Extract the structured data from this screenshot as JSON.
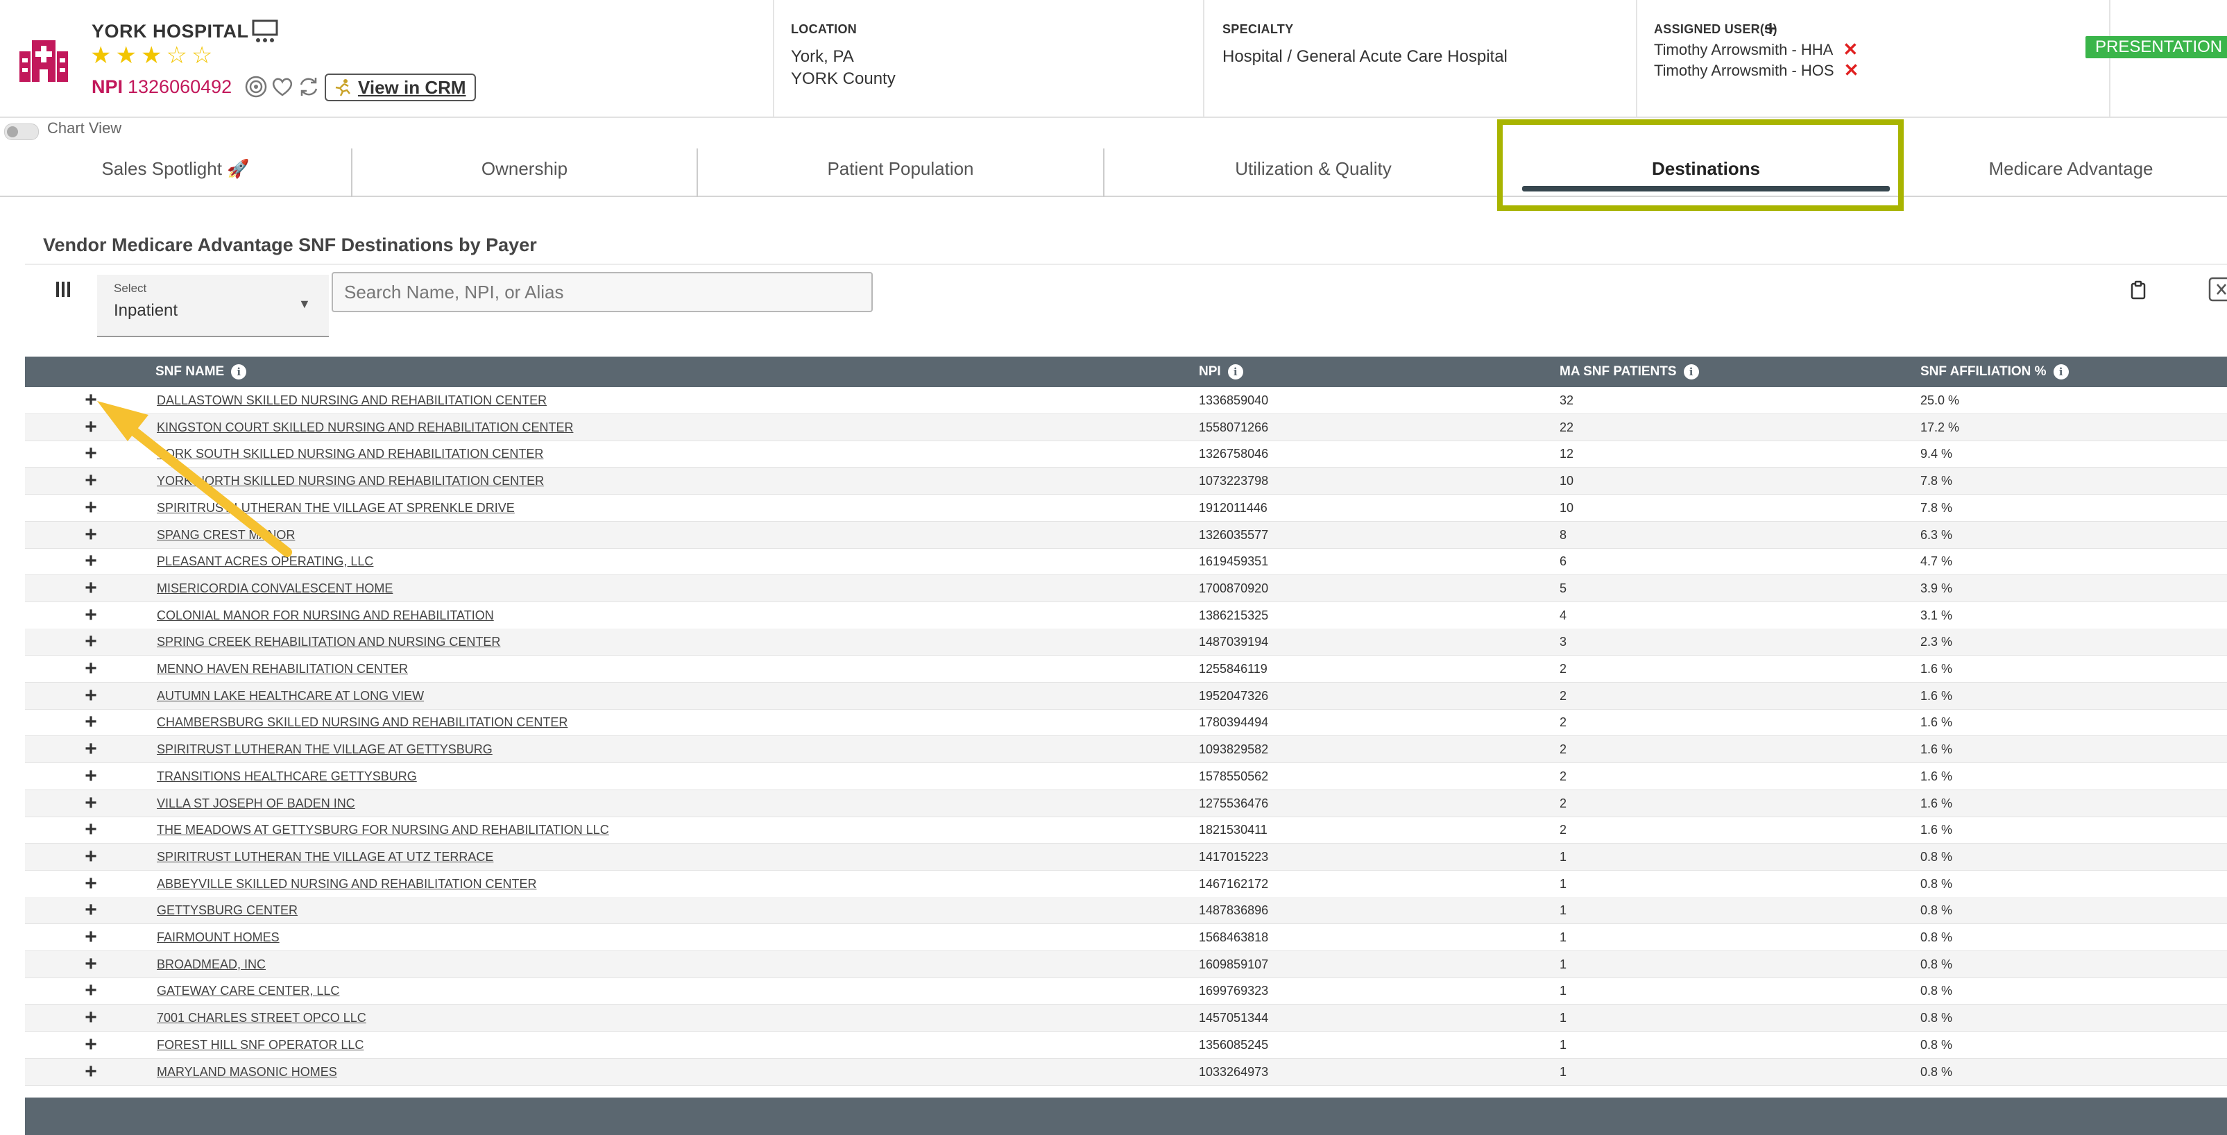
{
  "header": {
    "hospital_name": "YORK HOSPITAL",
    "stars": "★★★☆☆",
    "npi_label": "NPI",
    "npi_value": "1326060492",
    "view_crm_label": "View in CRM",
    "location_label": "LOCATION",
    "location_city": "York, PA",
    "location_county": "YORK County",
    "specialty_label": "SPECIALTY",
    "specialty_value": "Hospital / General Acute Care Hospital",
    "assigned_label": "ASSIGNED USER(S)",
    "assigned_users": [
      "Timothy Arrowsmith - HHA",
      "Timothy Arrowsmith - HOS"
    ],
    "status_badge": "PRESENTATION"
  },
  "chart_view_label": "Chart View",
  "tabs": [
    {
      "label": "Sales Spotlight 🚀"
    },
    {
      "label": "Ownership"
    },
    {
      "label": "Patient Population"
    },
    {
      "label": "Utilization & Quality"
    },
    {
      "label": "Destinations"
    },
    {
      "label": "Medicare Advantage"
    }
  ],
  "section_title": "Vendor Medicare Advantage SNF Destinations by Payer",
  "filter": {
    "select_label": "Select",
    "select_value": "Inpatient",
    "search_placeholder": "Search Name, NPI, or Alias"
  },
  "table": {
    "columns": [
      "SNF NAME",
      "NPI",
      "MA SNF PATIENTS",
      "SNF AFFILIATION %"
    ],
    "rows": [
      [
        "DALLASTOWN SKILLED NURSING AND REHABILITATION CENTER",
        "1336859040",
        "32",
        "25.0 %"
      ],
      [
        "KINGSTON COURT SKILLED NURSING AND REHABILITATION CENTER",
        "1558071266",
        "22",
        "17.2 %"
      ],
      [
        "YORK SOUTH SKILLED NURSING AND REHABILITATION CENTER",
        "1326758046",
        "12",
        "9.4 %"
      ],
      [
        "YORK NORTH SKILLED NURSING AND REHABILITATION CENTER",
        "1073223798",
        "10",
        "7.8 %"
      ],
      [
        "SPIRITRUST LUTHERAN THE VILLAGE AT SPRENKLE DRIVE",
        "1912011446",
        "10",
        "7.8 %"
      ],
      [
        "SPANG CREST MANOR",
        "1326035577",
        "8",
        "6.3 %"
      ],
      [
        "PLEASANT ACRES OPERATING, LLC",
        "1619459351",
        "6",
        "4.7 %"
      ],
      [
        "MISERICORDIA CONVALESCENT HOME",
        "1700870920",
        "5",
        "3.9 %"
      ],
      [
        "COLONIAL MANOR FOR NURSING AND REHABILITATION",
        "1386215325",
        "4",
        "3.1 %"
      ],
      [
        "SPRING CREEK REHABILITATION AND NURSING CENTER",
        "1487039194",
        "3",
        "2.3 %"
      ],
      [
        "MENNO HAVEN REHABILITATION CENTER",
        "1255846119",
        "2",
        "1.6 %"
      ],
      [
        "AUTUMN LAKE HEALTHCARE AT LONG VIEW",
        "1952047326",
        "2",
        "1.6 %"
      ],
      [
        "CHAMBERSBURG SKILLED NURSING AND REHABILITATION CENTER",
        "1780394494",
        "2",
        "1.6 %"
      ],
      [
        "SPIRITRUST LUTHERAN THE VILLAGE AT GETTYSBURG",
        "1093829582",
        "2",
        "1.6 %"
      ],
      [
        "TRANSITIONS HEALTHCARE GETTYSBURG",
        "1578550562",
        "2",
        "1.6 %"
      ],
      [
        "VILLA ST JOSEPH OF BADEN INC",
        "1275536476",
        "2",
        "1.6 %"
      ],
      [
        "THE MEADOWS AT GETTYSBURG FOR NURSING AND REHABILITATION LLC",
        "1821530411",
        "2",
        "1.6 %"
      ],
      [
        "SPIRITRUST LUTHERAN THE VILLAGE AT UTZ TERRACE",
        "1417015223",
        "1",
        "0.8 %"
      ],
      [
        "ABBEYVILLE SKILLED NURSING AND REHABILITATION CENTER",
        "1467162172",
        "1",
        "0.8 %"
      ],
      [
        "GETTYSBURG CENTER",
        "1487836896",
        "1",
        "0.8 %"
      ],
      [
        "FAIRMOUNT HOMES",
        "1568463818",
        "1",
        "0.8 %"
      ],
      [
        "BROADMEAD, INC",
        "1609859107",
        "1",
        "0.8 %"
      ],
      [
        "GATEWAY CARE CENTER, LLC",
        "1699769323",
        "1",
        "0.8 %"
      ],
      [
        "7001 CHARLES STREET OPCO LLC",
        "1457051344",
        "1",
        "0.8 %"
      ],
      [
        "FOREST HILL SNF OPERATOR LLC",
        "1356085245",
        "1",
        "0.8 %"
      ],
      [
        "MARYLAND MASONIC HOMES",
        "1033264973",
        "1",
        "0.8 %"
      ]
    ]
  },
  "colors": {
    "brand_pink": "#c2185b",
    "star_gold": "#f2c500",
    "status_green": "#3ab54a",
    "header_gray": "#5b6770",
    "highlight_olive": "#a8b400",
    "arrow_yellow": "#f6c12f",
    "remove_red": "#e02020"
  },
  "icons": [
    "hospital-icon",
    "presentation-icon",
    "target-icon",
    "heart-icon",
    "sync-icon",
    "crm-runner-icon",
    "columns-icon",
    "clipboard-icon",
    "excel-export-icon",
    "info-icon",
    "plus-icon",
    "close-icon",
    "add-icon"
  ]
}
